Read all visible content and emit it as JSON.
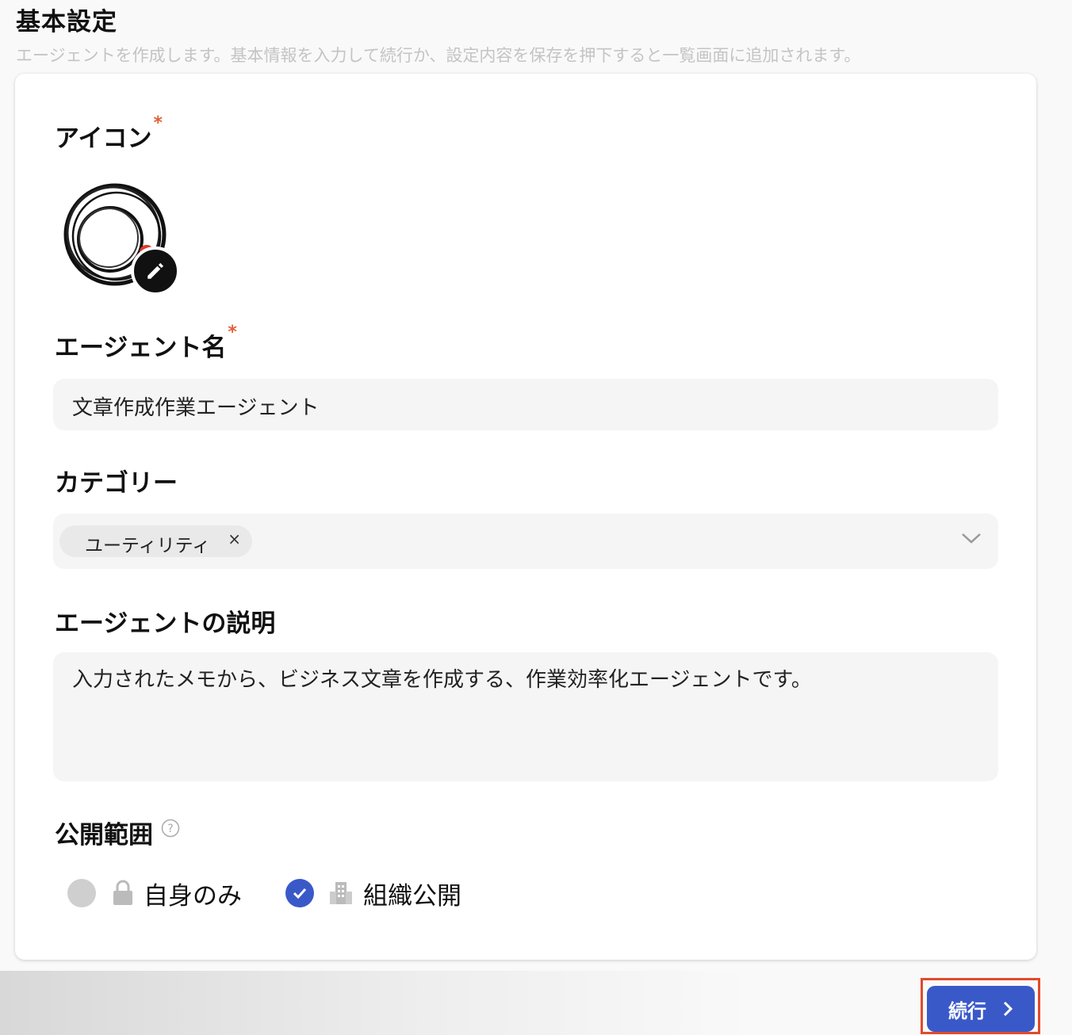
{
  "header": {
    "title": "基本設定",
    "subtitle": "エージェントを作成します。基本情報を入力して続行か、設定内容を保存を押下すると一覧画面に追加されます。"
  },
  "form": {
    "icon": {
      "label": "アイコン",
      "required_mark": "*"
    },
    "agent_name": {
      "label": "エージェント名",
      "required_mark": "*",
      "value": "文章作成作業エージェント"
    },
    "category": {
      "label": "カテゴリー",
      "selected_chip": "ユーティリティ",
      "remove_symbol": "×"
    },
    "description": {
      "label": "エージェントの説明",
      "value": "入力されたメモから、ビジネス文章を作成する、作業効率化エージェントです。"
    },
    "visibility": {
      "label": "公開範囲",
      "help_symbol": "?",
      "options": [
        {
          "label": "自身のみ",
          "icon": "lock-icon",
          "selected": false
        },
        {
          "label": "組織公開",
          "icon": "building-icon",
          "selected": true
        }
      ]
    }
  },
  "footer": {
    "continue_label": "続行"
  },
  "colors": {
    "accent": "#3a59c9",
    "required": "#e0603a",
    "highlight_border": "#e04a2c"
  }
}
